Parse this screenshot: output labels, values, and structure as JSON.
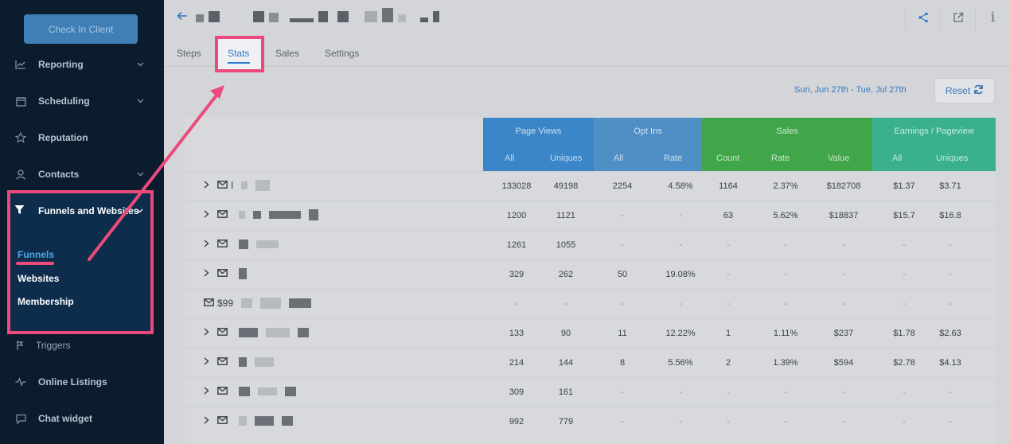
{
  "sidebar": {
    "checkin_label": "Check In Client",
    "items": [
      {
        "label": "Reporting",
        "icon": "chart-line-icon",
        "chevron": true
      },
      {
        "label": "Scheduling",
        "icon": "calendar-icon",
        "chevron": true
      },
      {
        "label": "Reputation",
        "icon": "star-icon",
        "chevron": false
      },
      {
        "label": "Contacts",
        "icon": "person-icon",
        "chevron": true
      },
      {
        "label": "Funnels and Websites",
        "icon": "funnel-icon",
        "chevron": true
      },
      {
        "label": "Triggers",
        "icon": "trigger-icon",
        "chevron": false
      },
      {
        "label": "Online Listings",
        "icon": "pulse-icon",
        "chevron": false
      },
      {
        "label": "Chat widget",
        "icon": "chat-icon",
        "chevron": false
      }
    ],
    "sub_items": [
      "Funnels",
      "Websites",
      "Membership"
    ]
  },
  "header": {
    "tabs": [
      "Steps",
      "Stats",
      "Sales",
      "Settings"
    ],
    "active_tab": "Stats",
    "icons": [
      "share-icon",
      "external-link-icon",
      "info-icon"
    ]
  },
  "filters": {
    "date_range": "Sun, Jun 27th - Tue, Jul 27th",
    "reset_label": "Reset"
  },
  "table": {
    "groups": [
      {
        "label": "Page Views",
        "color": "#3a86c8",
        "subs": [
          "All",
          "Uniques"
        ]
      },
      {
        "label": "Opt Ins",
        "color": "#4f8fc6",
        "subs": [
          "All",
          "Rate"
        ]
      },
      {
        "label": "Sales",
        "color": "#41a64a",
        "subs": [
          "Count",
          "Rate",
          "Value"
        ]
      },
      {
        "label": "Earnings / Pageview",
        "color": "#3bb08f",
        "subs": [
          "All",
          "Uniques"
        ]
      }
    ],
    "rows": [
      {
        "lead": "I",
        "vals": [
          "133028",
          "49198",
          "2254",
          "4.58%",
          "1164",
          "2.37%",
          "$182708",
          "$1.37",
          "$3.71"
        ]
      },
      {
        "lead": "",
        "vals": [
          "1200",
          "1121",
          "-",
          "-",
          "63",
          "5.62%",
          "$18837",
          "$15.7",
          "$16.8"
        ]
      },
      {
        "lead": "",
        "vals": [
          "1261",
          "1055",
          "-",
          "-",
          "-",
          "-",
          "-",
          "-",
          "-"
        ]
      },
      {
        "lead": "",
        "vals": [
          "329",
          "262",
          "50",
          "19.08%",
          "-",
          "-",
          "-",
          "-",
          "-"
        ]
      },
      {
        "lead": "$99",
        "vals": [
          "-",
          "-",
          "-",
          "-",
          "-",
          "-",
          "-",
          "-",
          "-"
        ]
      },
      {
        "lead": "",
        "vals": [
          "133",
          "90",
          "11",
          "12.22%",
          "1",
          "1.11%",
          "$237",
          "$1.78",
          "$2.63"
        ]
      },
      {
        "lead": "",
        "vals": [
          "214",
          "144",
          "8",
          "5.56%",
          "2",
          "1.39%",
          "$594",
          "$2.78",
          "$4.13"
        ]
      },
      {
        "lead": "",
        "vals": [
          "309",
          "161",
          "-",
          "-",
          "-",
          "-",
          "-",
          "-",
          "-"
        ]
      },
      {
        "lead": "",
        "vals": [
          "992",
          "779",
          "-",
          "-",
          "-",
          "-",
          "-",
          "-",
          "-"
        ]
      }
    ]
  },
  "annotation_color": "#ec4a7c"
}
